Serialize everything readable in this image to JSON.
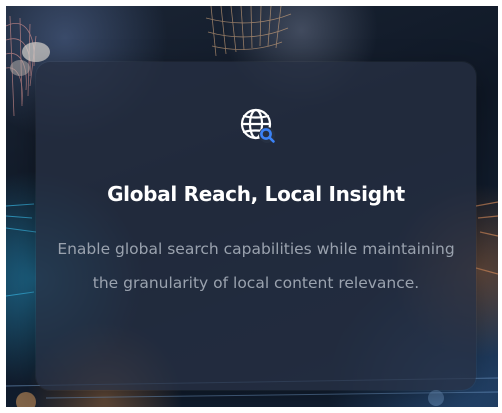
{
  "feature_card": {
    "icon": "globe-search-icon",
    "title": "Global Reach, Local Insight",
    "description": "Enable global search capabilities while maintaining the granularity of local content relevance."
  },
  "colors": {
    "accent": "#3b82f6",
    "title": "#ffffff",
    "description": "#9aa2ae"
  }
}
